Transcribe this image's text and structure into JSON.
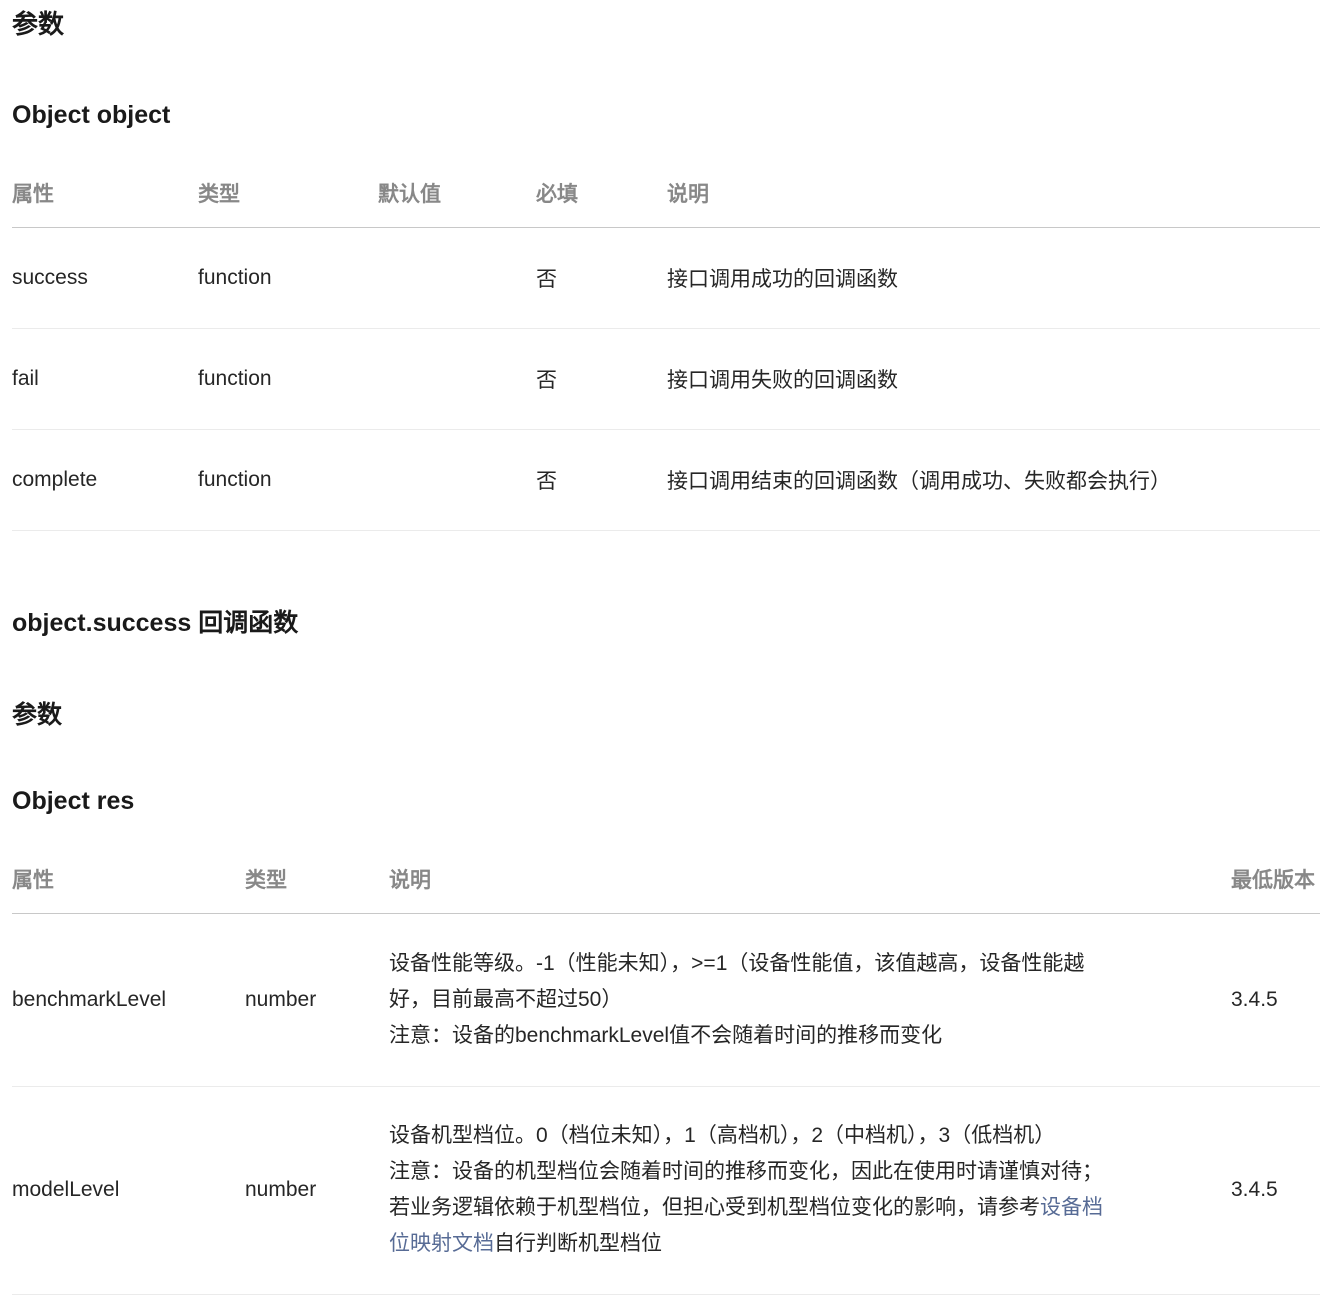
{
  "section1": {
    "params_title": "参数",
    "object_title": "Object object",
    "table": {
      "headers": [
        "属性",
        "类型",
        "默认值",
        "必填",
        "说明"
      ],
      "rows": [
        {
          "name": "success",
          "type": "function",
          "default": "",
          "required": "否",
          "desc": "接口调用成功的回调函数"
        },
        {
          "name": "fail",
          "type": "function",
          "default": "",
          "required": "否",
          "desc": "接口调用失败的回调函数"
        },
        {
          "name": "complete",
          "type": "function",
          "default": "",
          "required": "否",
          "desc": "接口调用结束的回调函数（调用成功、失败都会执行）"
        }
      ]
    }
  },
  "section2": {
    "callback_title": "object.success 回调函数",
    "params_title": "参数",
    "object_title": "Object res",
    "table": {
      "headers": [
        "属性",
        "类型",
        "说明",
        "最低版本"
      ],
      "rows": [
        {
          "name": "benchmarkLevel",
          "type": "number",
          "desc_line1": "设备性能等级。-1（性能未知），>=1（设备性能值，该值越高，设备性能越",
          "desc_line2": "好，目前最高不超过50）",
          "desc_line3": "注意：设备的benchmarkLevel值不会随着时间的推移而变化",
          "version": "3.4.5"
        },
        {
          "name": "modelLevel",
          "type": "number",
          "desc_line1": "设备机型档位。0（档位未知），1（高档机），2（中档机），3（低档机）",
          "desc_line2": "注意：设备的机型档位会随着时间的推移而变化，因此在使用时请谨慎对待；",
          "desc_line3_pre": "若业务逻辑依赖于机型档位，但担心受到机型档位变化的影响，请参考",
          "desc_link_part1": "设备档",
          "desc_link_part2": "位映射文档",
          "desc_line4_post": "自行判断机型档位",
          "version": "3.4.5"
        }
      ]
    }
  }
}
